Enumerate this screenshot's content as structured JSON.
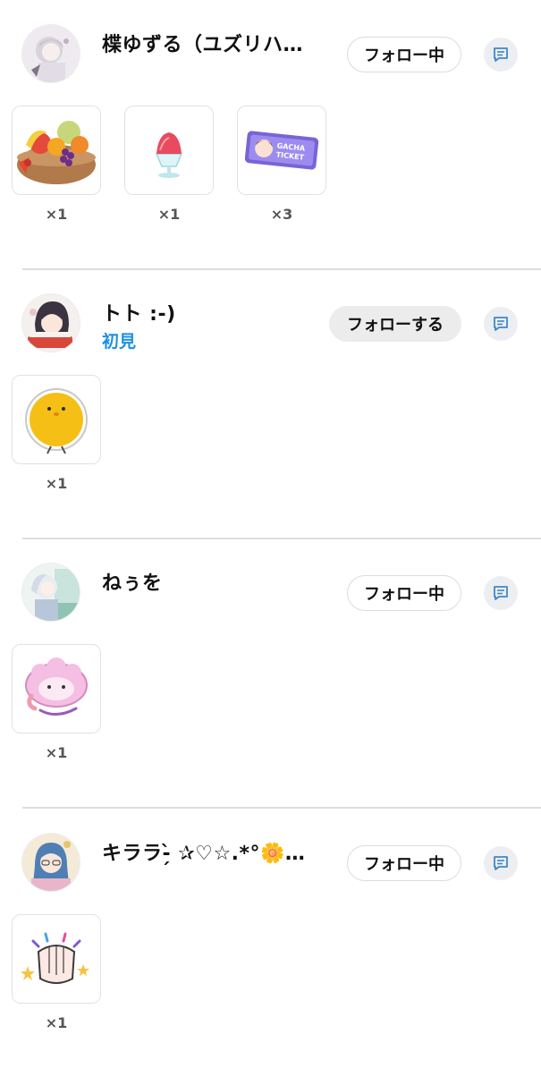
{
  "entries": [
    {
      "name": "楪ゆずる（ユズリハ…",
      "tag": "",
      "follow": {
        "label": "フォロー中",
        "state": "following"
      },
      "avatar_icon": "avatar-silver-hair-character",
      "gifts": [
        {
          "icon": "fruit-basket-icon",
          "count": "×1"
        },
        {
          "icon": "shaved-ice-icon",
          "count": "×1"
        },
        {
          "icon": "gacha-ticket-icon",
          "count": "×3",
          "ticket_text": [
            "GACHA",
            "TICKET"
          ]
        }
      ]
    },
    {
      "name": "トト :-)",
      "tag": "初見",
      "follow": {
        "label": "フォローする",
        "state": "not-following"
      },
      "avatar_icon": "avatar-dark-hair-character",
      "gifts": [
        {
          "icon": "yellow-chick-sticker-icon",
          "count": "×1"
        }
      ]
    },
    {
      "name": "ねぅを",
      "tag": "",
      "follow": {
        "label": "フォロー中",
        "state": "following"
      },
      "avatar_icon": "avatar-white-hair-character",
      "gifts": [
        {
          "icon": "pink-sheep-sticker-icon",
          "count": "×1"
        }
      ]
    },
    {
      "name": "キララ-̗̀ ✰♡☆.*°🌼…",
      "tag": "",
      "follow": {
        "label": "フォロー中",
        "state": "following"
      },
      "avatar_icon": "avatar-blue-hair-character",
      "gifts": [
        {
          "icon": "clapping-hands-sticker-icon",
          "count": "×1"
        }
      ]
    }
  ],
  "colors": {
    "tag_blue": "#1d8fe3",
    "divider": "#dedede",
    "follow_bg": "#ececec",
    "message_icon": "#3f87c8"
  }
}
